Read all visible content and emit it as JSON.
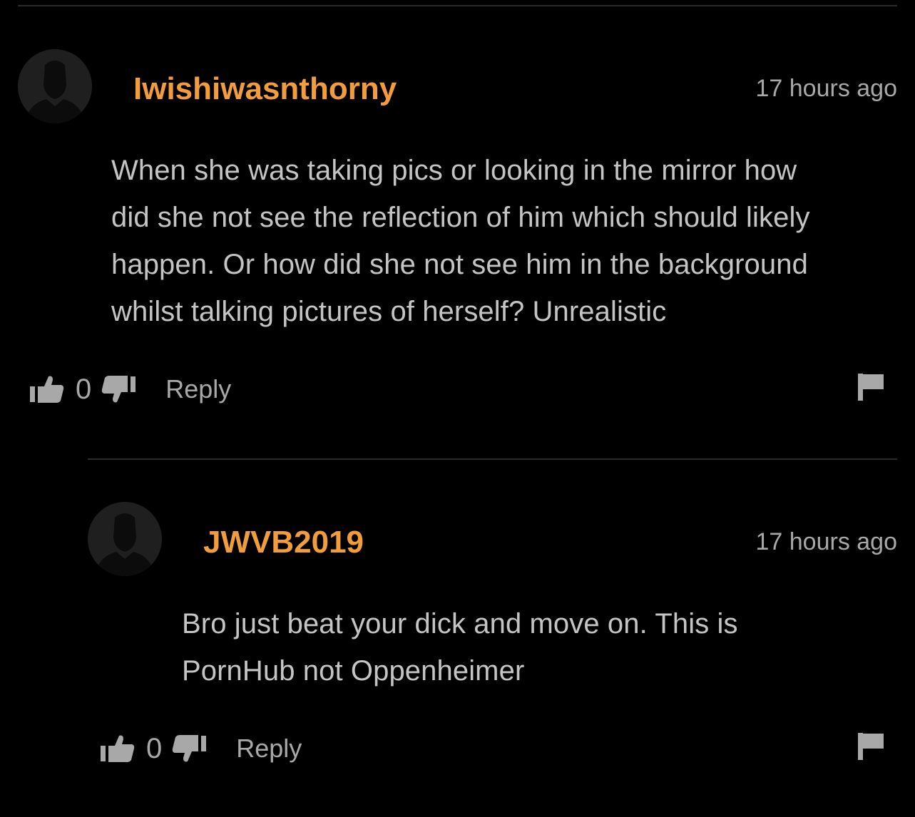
{
  "comments": [
    {
      "username": "Iwishiwasnthorny",
      "timestamp": "17 hours ago",
      "lines": [
        "When she was taking pics or looking in the mirror how",
        "did she not see the reflection of him which should likely",
        "happen. Or how did she not see him in the background",
        "whilst talking pictures of herself? Unrealistic"
      ],
      "votes": "0",
      "reply_label": "Reply"
    },
    {
      "username": "JWVB2019",
      "timestamp": "17 hours ago",
      "lines": [
        "Bro just beat your dick and move on. This is",
        "PornHub not Oppenheimer"
      ],
      "votes": "0",
      "reply_label": "Reply"
    }
  ],
  "colors": {
    "background": "#000000",
    "username": "#f19d3b",
    "text": "#c4c4c4",
    "muted": "#a8a8a8",
    "divider": "#2b2b2b"
  },
  "icons": {
    "avatar": "user-silhouette-icon",
    "upvote": "thumbs-up-icon",
    "downvote": "thumbs-down-icon",
    "flag": "flag-icon"
  }
}
